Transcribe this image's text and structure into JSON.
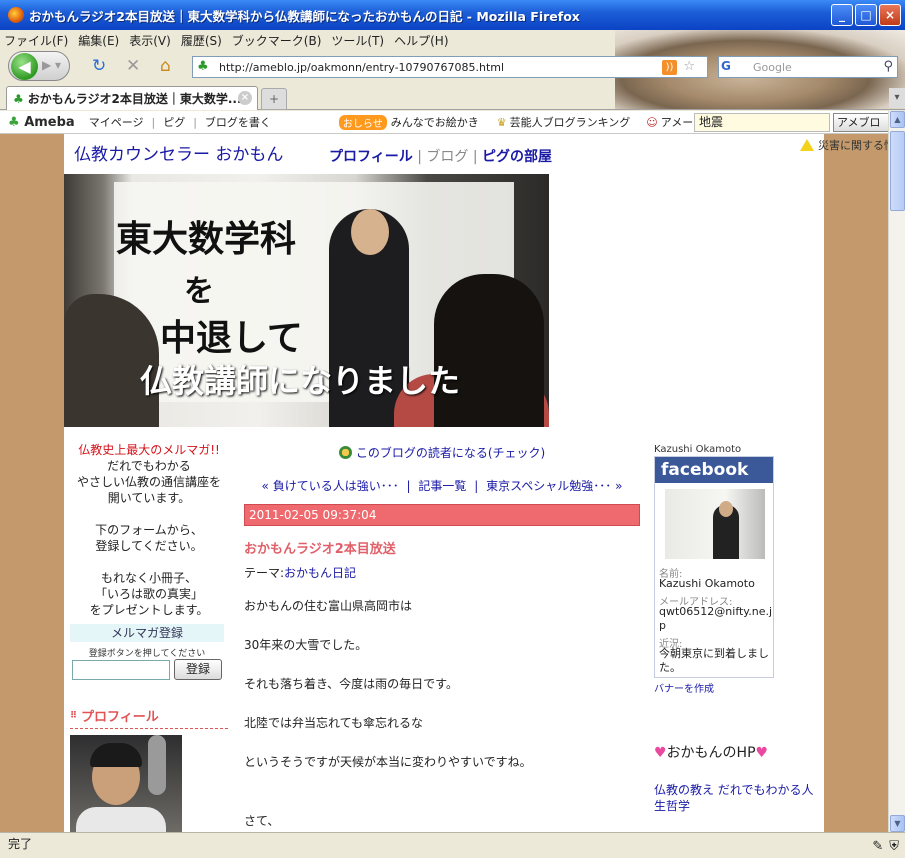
{
  "window": {
    "title": "おかもんラジオ2本目放送｜東大数学科から仏教講師になったおかもんの日記 - Mozilla Firefox",
    "buttons": [
      "_",
      "□",
      "×"
    ]
  },
  "menu": [
    "ファイル(F)",
    "編集(E)",
    "表示(V)",
    "履歴(S)",
    "ブックマーク(B)",
    "ツール(T)",
    "ヘルプ(H)"
  ],
  "nav": {
    "url": "http://ameblo.jp/oakmonn/entry-10790767085.html",
    "search_placeholder": "Google"
  },
  "tab": {
    "label": "おかもんラジオ2本目放送｜東大数学..."
  },
  "ameba": {
    "logo": "Ameba",
    "links": [
      "マイページ",
      "ピグ",
      "ブログを書く"
    ],
    "oshirase_badge": "おしらせ",
    "oshirase_text": "みんなでお絵かき",
    "ranking": "芸能人ブログランキング",
    "member": "アメーバ会員登録",
    "keyword": "地震",
    "search_button": "アメブロ"
  },
  "disaster_notice": "災害に関する情",
  "blog": {
    "title": "仏教カウンセラー おかもん",
    "nav": [
      "プロフィール",
      "ブログ",
      "ピグの部屋"
    ],
    "header_caption": [
      "東大数学科",
      "を",
      "中退して",
      "仏教講師になりました"
    ]
  },
  "left": {
    "promo_red": "仏教史上最大のメルマガ!!",
    "promo_lines": [
      "だれでもわかる",
      "やさしい仏教の通信講座を",
      "開いています。",
      "",
      "下のフォームから、",
      "登録してください。",
      "",
      "もれなく小冊子、",
      "「いろは歌の真実」",
      "をプレゼントします。"
    ],
    "mm_title": "メルマガ登録",
    "mm_hint": "登録ボタンを押してください",
    "mm_button": "登録",
    "profile_title": "プロフィール"
  },
  "main": {
    "reader": "このブログの読者になる(チェック)",
    "pager": {
      "prev": "« 負けている人は強い･･･",
      "list": "記事一覧",
      "next": "東京スペシャル勉強･･･ »"
    },
    "date": "2011-02-05 09:37:04",
    "entry_title": "おかもんラジオ2本目放送",
    "theme_label": "テーマ:",
    "theme_link": "おかもん日記",
    "paragraphs": [
      "おかもんの住む富山県高岡市は",
      "30年来の大雪でした。",
      "それも落ち着き、今度は雨の毎日です。",
      "北陸では弁当忘れても傘忘れるな",
      "というそうですが天候が本当に変わりやすいですね。",
      "さて、"
    ]
  },
  "right": {
    "fb_name": "Kazushi Okamoto",
    "fb_logo": "facebook",
    "name_label": "名前:",
    "name_value": "Kazushi Okamoto",
    "mail_label": "メールアドレス:",
    "mail_value": "qwt06512@nifty.ne.jp",
    "recent_label": "近況:",
    "recent_value": "今朝東京に到着しました。",
    "banner": "バナーを作成",
    "hp_title": "おかもんのHP",
    "hp_link": "仏教の教え だれでもわかる人生哲学"
  },
  "status": {
    "text": "完了"
  }
}
